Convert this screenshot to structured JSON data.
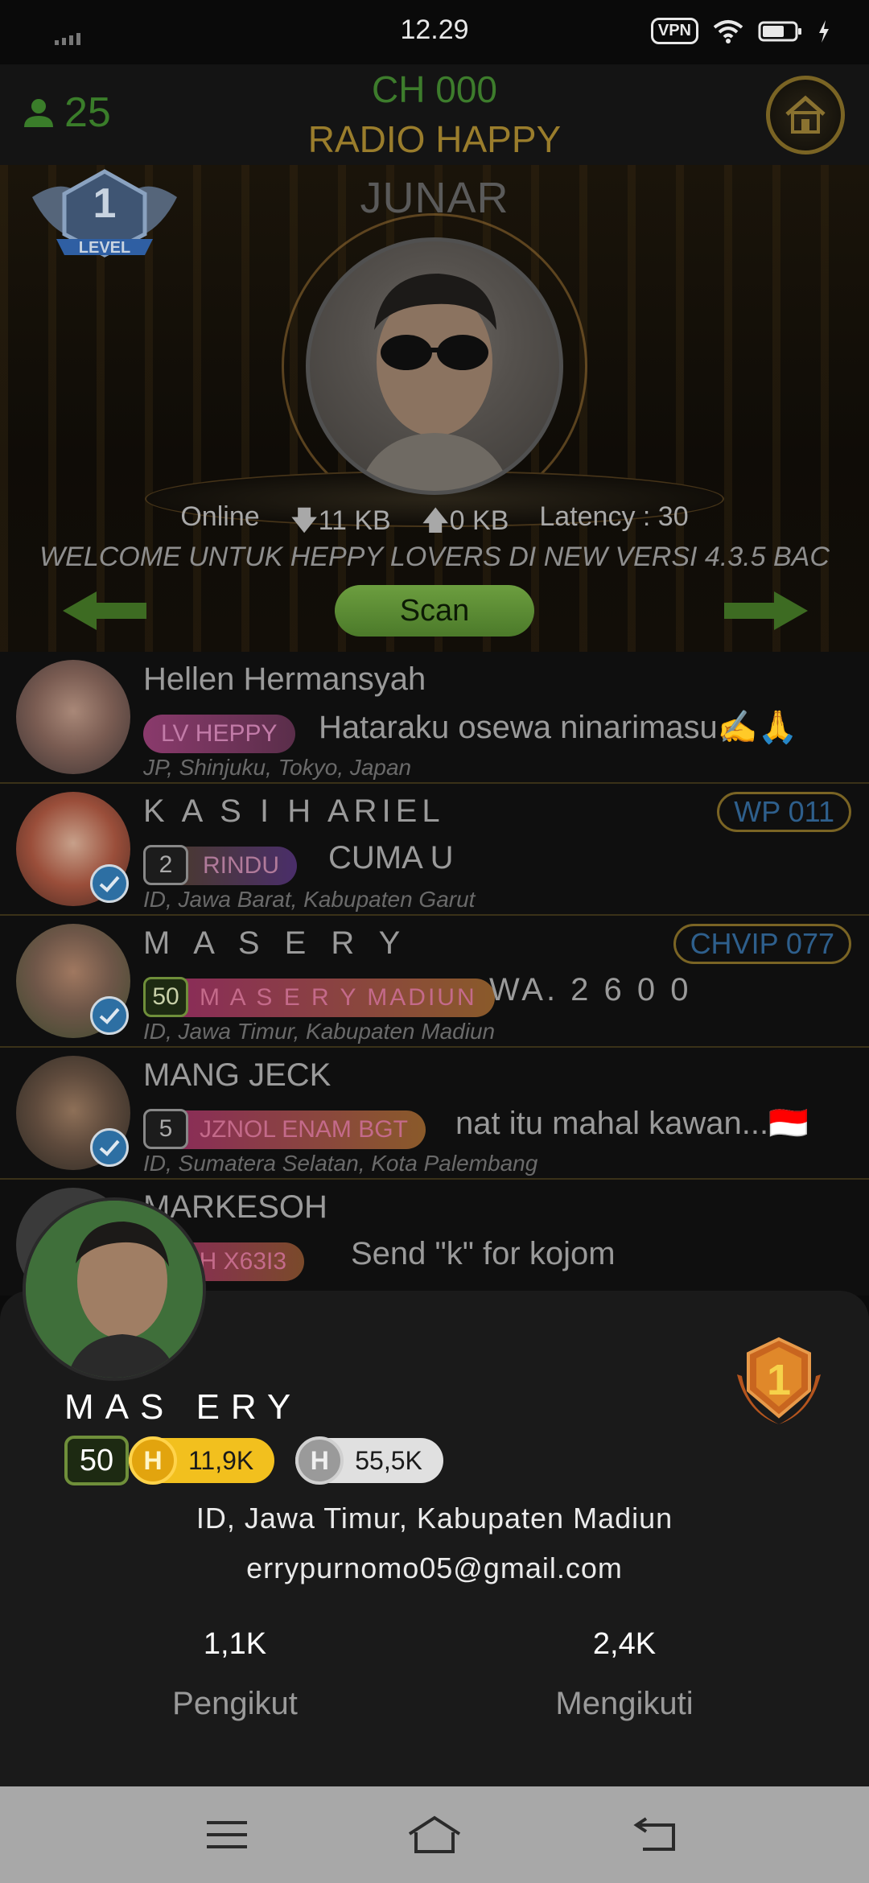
{
  "status_bar": {
    "time": "12.29",
    "vpn": "VPN"
  },
  "header": {
    "listener_count": "25",
    "channel_code": "CH 000",
    "channel_name": "RADIO HAPPY"
  },
  "stage": {
    "host_name": "JUNAR",
    "level_badge_number": "1",
    "level_badge_text": "LEVEL",
    "online_label": "Online",
    "download": "11 KB",
    "upload": "0 KB",
    "latency": "Latency : 30",
    "marquee": "WELCOME UNTUK HEPPY LOVERS DI NEW VERSI 4.3.5 BAC",
    "scan_label": "Scan"
  },
  "users": [
    {
      "name": "Hellen Hermansyah",
      "level": "",
      "tag": "LV HEPPY",
      "message": "Hataraku osewa ninarimasu✍️🙏",
      "location": "JP, Shinjuku, Tokyo, Japan",
      "channel": ""
    },
    {
      "name": "K A S I H ARIEL",
      "level": "2",
      "tag": "RINDU",
      "message": "CUMA U",
      "location": "ID, Jawa Barat, Kabupaten Garut",
      "channel": "WP 011"
    },
    {
      "name": "M A S   E R Y",
      "level": "50",
      "tag": "M A S E R Y MADIUN",
      "message": "WA. 2 6 0 0",
      "location": "ID, Jawa Timur, Kabupaten Madiun",
      "channel": "CHVIP 077"
    },
    {
      "name": "MANG JECK",
      "level": "5",
      "tag": "JZNOL ENAM BGT",
      "message": "nat itu mahal kawan...🇮🇩",
      "location": "ID, Sumatera Selatan, Kota Palembang",
      "channel": ""
    },
    {
      "name": "MARKESOH",
      "level": "",
      "tag": "HH  X63I3",
      "message": "Send \"k\" for kojom",
      "location": "",
      "channel": ""
    }
  ],
  "profile": {
    "name": "MAS  ERY",
    "level": "50",
    "gold_coins": "11,9K",
    "silver_coins": "55,5K",
    "coin_letter": "H",
    "rank": "1",
    "location": "ID, Jawa Timur, Kabupaten Madiun",
    "email": "errypurnomo05@gmail.com",
    "followers_value": "1,1K",
    "followers_label": "Pengikut",
    "following_value": "2,4K",
    "following_label": "Mengikuti"
  },
  "colors": {
    "accent_green": "#3d7c2c",
    "accent_gold": "#9a7d2c",
    "channel_blue": "#2e5f8c",
    "sheet_bg": "#1a1a1a"
  }
}
